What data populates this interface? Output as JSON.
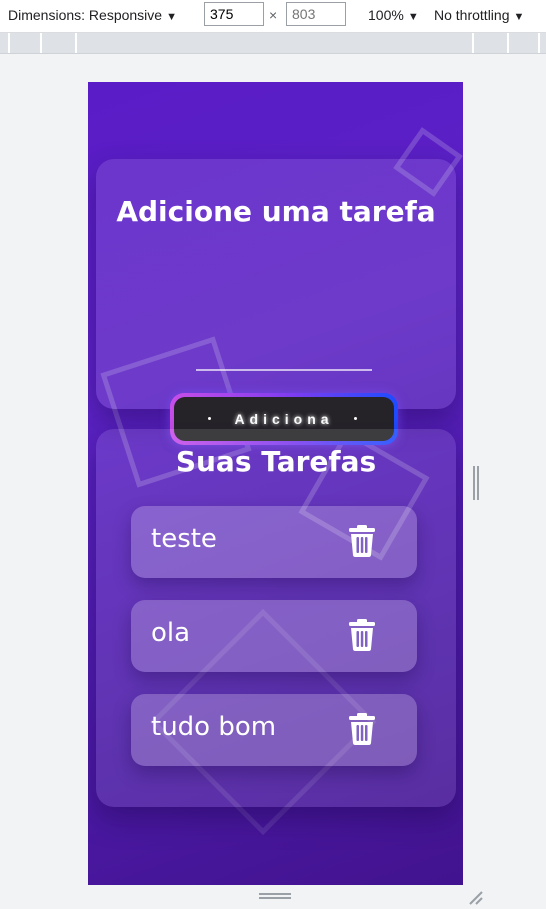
{
  "devtools": {
    "dimensions_label": "Dimensions: Responsive",
    "width_value": "375",
    "times": "×",
    "height_placeholder": "803",
    "zoom_label": "100%",
    "throttling_label": "No throttling"
  },
  "add_card": {
    "title": "Adicione uma tarefa",
    "input_value": "",
    "button_label": "Adiciona"
  },
  "tasks_card": {
    "title": "Suas Tarefas",
    "items": [
      {
        "label": "teste"
      },
      {
        "label": "ola"
      },
      {
        "label": "tudo bom"
      }
    ]
  },
  "icons": {
    "delete": "trash-icon"
  },
  "colors": {
    "background_top": "#5a1cc7",
    "background_bottom": "#42138f",
    "button_gradient_start": "#c84ee8",
    "button_gradient_end": "#1d4cff",
    "button_fill": "#262428"
  }
}
